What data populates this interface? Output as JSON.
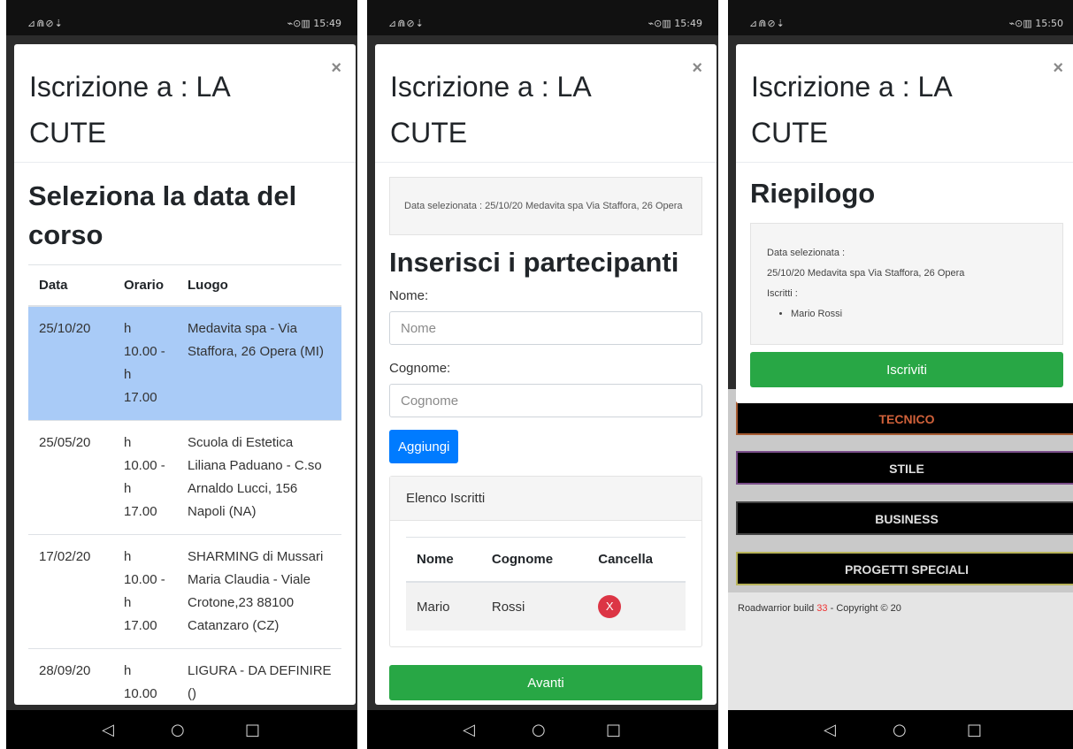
{
  "status": {
    "left_icons": "⊿⋒⊘⇣",
    "right": [
      "⌁⊙▥ 15:49",
      "⌁⊙▥ 15:49",
      "⌁⊙▥ 15:50"
    ]
  },
  "nav": {
    "back": "◁",
    "home": "○",
    "recent": "□"
  },
  "modal": {
    "title": "Iscrizione a : LA CUTE",
    "close": "×"
  },
  "panel1": {
    "heading": "Seleziona la data del corso",
    "columns": [
      "Data",
      "Orario",
      "Luogo"
    ],
    "rows": [
      {
        "date": "25/10/20",
        "time": "h 10.00 - h 17.00",
        "place": "Medavita spa - Via Staffora, 26 Opera (MI)"
      },
      {
        "date": "25/05/20",
        "time": "h 10.00 - h 17.00",
        "place": "Scuola di Estetica Liliana Paduano - C.so Arnaldo Lucci, 156 Napoli (NA)"
      },
      {
        "date": "17/02/20",
        "time": "h 10.00 - h 17.00",
        "place": "SHARMING di Mussari Maria Claudia - Viale Crotone,23 88100 Catanzaro (CZ)"
      },
      {
        "date": "28/09/20",
        "time": "h 10.00",
        "place": "LIGURA - DA DEFINIRE ()"
      }
    ]
  },
  "panel2": {
    "selected": "Data selezionata : 25/10/20 Medavita spa Via Staffora, 26 Opera",
    "heading": "Inserisci i partecipanti",
    "nome_label": "Nome:",
    "nome_placeholder": "Nome",
    "cognome_label": "Cognome:",
    "cognome_placeholder": "Cognome",
    "add_button": "Aggiungi",
    "list_title": "Elenco Iscritti",
    "columns": [
      "Nome",
      "Cognome",
      "Cancella"
    ],
    "row": {
      "nome": "Mario",
      "cognome": "Rossi",
      "delete": "X"
    },
    "next_button": "Avanti"
  },
  "panel3": {
    "heading": "Riepilogo",
    "selected_label": "Data selezionata :",
    "selected_value": "25/10/20 Medavita spa Via Staffora, 26 Opera",
    "iscritti_label": "Iscritti :",
    "iscritti": [
      "Mario Rossi"
    ],
    "submit_button": "Iscriviti",
    "menu": [
      "TECNICO",
      "STILE",
      "BUSINESS",
      "PROGETTI SPECIALI"
    ],
    "footer_prefix": "Roadwarrior build",
    "footer_build": "33",
    "footer_suffix": "- Copyright © 20"
  }
}
